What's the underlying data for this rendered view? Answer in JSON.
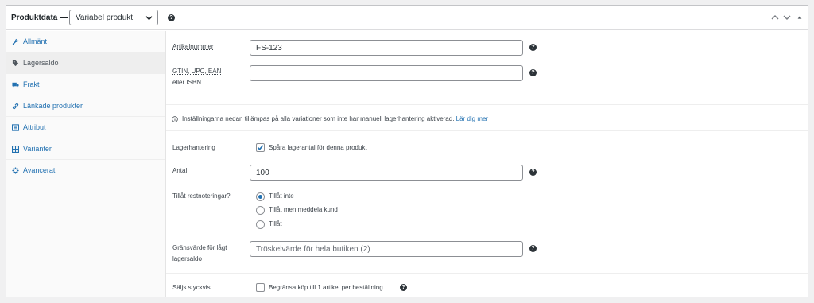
{
  "header": {
    "title": "Produktdata —",
    "product_type": "Variabel produkt"
  },
  "sidebar": {
    "items": [
      {
        "label": "Allmänt",
        "icon": "wrench-icon"
      },
      {
        "label": "Lagersaldo",
        "icon": "tag-icon",
        "active": true
      },
      {
        "label": "Frakt",
        "icon": "truck-icon"
      },
      {
        "label": "Länkade produkter",
        "icon": "link-icon"
      },
      {
        "label": "Attribut",
        "icon": "list-icon"
      },
      {
        "label": "Varianter",
        "icon": "grid-icon"
      },
      {
        "label": "Avancerat",
        "icon": "gear-icon"
      }
    ]
  },
  "inventory": {
    "sku_label": "Artikelnummer",
    "sku_value": "FS-123",
    "gtin_label_line1": "GTIN, UPC, EAN",
    "gtin_label_line2": "eller ISBN",
    "gtin_value": "",
    "notice_text": "Inställningarna nedan tillämpas på alla variationer som inte har manuell lagerhantering aktiverad.",
    "notice_link": "Lär dig mer",
    "stock_mgmt_label": "Lagerhantering",
    "stock_mgmt_checkbox": "Spåra lagerantal för denna produkt",
    "stock_mgmt_checked": true,
    "qty_label": "Antal",
    "qty_value": "100",
    "backorders_label": "Tillåt restnoteringar?",
    "backorders_options": [
      "Tillåt inte",
      "Tillåt men meddela kund",
      "Tillåt"
    ],
    "backorders_selected": "Tillåt inte",
    "low_stock_label_line1": "Gränsvärde för lågt",
    "low_stock_label_line2": "lagersaldo",
    "low_stock_placeholder": "Tröskelvärde för hela butiken (2)",
    "sold_individually_label": "Säljs styckvis",
    "sold_individually_checkbox": "Begränsa köp till 1 artikel per beställning",
    "sold_individually_checked": false
  },
  "colors": {
    "accent": "#2271b1",
    "border": "#8c8f94",
    "active_tab_bg": "#eeeeee"
  }
}
